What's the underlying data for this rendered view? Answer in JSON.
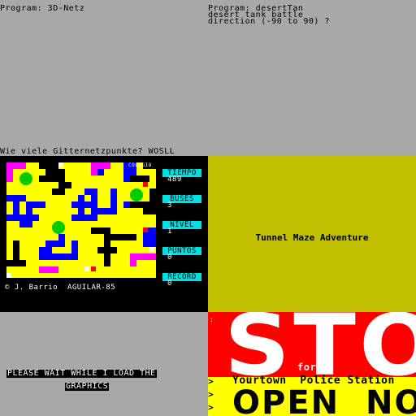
{
  "panel_tl": {
    "line": "Program: 3D-Netz"
  },
  "panel_tr": {
    "lines": [
      "Program: desertTan",
      "desert tank battle",
      "direction (-90 to 90) ?"
    ]
  },
  "panel_ml": {
    "prompt": "Wie viele Gitternetzpunkte? WOSLL",
    "colegio_label": "COLEGIO",
    "stats": [
      {
        "label": "TIEMPO",
        "value": "489"
      },
      {
        "label": "BUSES",
        "value": "3"
      },
      {
        "label": "NIVEL",
        "value": "1"
      },
      {
        "label": "PUNTOS",
        "value": "0"
      },
      {
        "label": "RECORD",
        "value": "0"
      }
    ],
    "credits": "© J. Barrio  AGUILAR-85",
    "colors": {
      "maze_yellow": "#ffff00",
      "maze_blue": "#0000ff",
      "maze_black": "#000000",
      "pink": "#ff00ff",
      "green": "#00cc00",
      "label_cyan": "#00e0e0"
    }
  },
  "panel_mr": {
    "title": "Tunnel Maze Adventure",
    "background": "#c0c000"
  },
  "panel_bl": {
    "line1": "PLEASE WAIT WHILE I LOAD THE",
    "line2": "GRAPHICS"
  },
  "panel_br": {
    "big_word": "STOP",
    "for_word": "for",
    "line1": "Yourtown  Police Station",
    "line2": "OPEN  NOV",
    "colors": {
      "background": "#ff0000",
      "band": "#ffff00",
      "text": "#ffffff"
    }
  }
}
